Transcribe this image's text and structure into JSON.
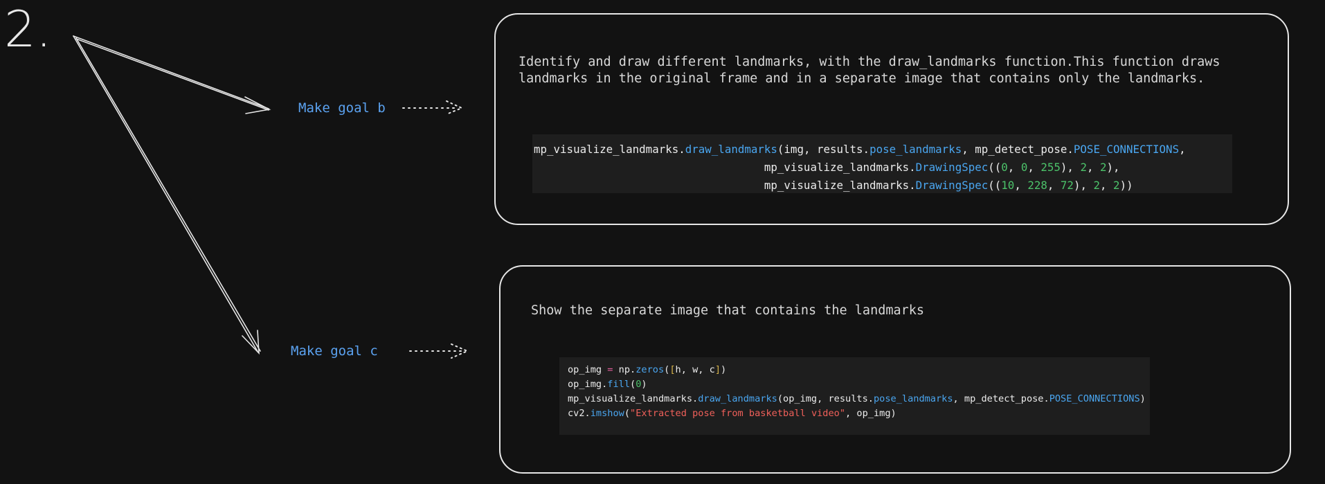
{
  "step": {
    "number": "2."
  },
  "goals": {
    "b": {
      "label": "Make goal b"
    },
    "c": {
      "label": "Make goal c"
    }
  },
  "card_b": {
    "description_line1": "Identify and draw different landmarks, with the draw_landmarks function.This function draws",
    "description_line2": "landmarks in the original frame and in a separate image that contains only the landmarks.",
    "code_lines": [
      [
        {
          "t": "mp_visualize_landmarks.",
          "k": "plain"
        },
        {
          "t": "draw_landmarks",
          "k": "fn"
        },
        {
          "t": "(img, results.",
          "k": "plain"
        },
        {
          "t": "pose_landmarks",
          "k": "fn"
        },
        {
          "t": ", mp_detect_pose.",
          "k": "plain"
        },
        {
          "t": "POSE_CONNECTIONS",
          "k": "fn"
        },
        {
          "t": ",",
          "k": "plain"
        }
      ],
      [
        {
          "t": "                                   mp_visualize_landmarks.",
          "k": "plain"
        },
        {
          "t": "DrawingSpec",
          "k": "fn"
        },
        {
          "t": "((",
          "k": "plain"
        },
        {
          "t": "0",
          "k": "num"
        },
        {
          "t": ", ",
          "k": "plain"
        },
        {
          "t": "0",
          "k": "num"
        },
        {
          "t": ", ",
          "k": "plain"
        },
        {
          "t": "255",
          "k": "num"
        },
        {
          "t": "), ",
          "k": "plain"
        },
        {
          "t": "2",
          "k": "num"
        },
        {
          "t": ", ",
          "k": "plain"
        },
        {
          "t": "2",
          "k": "num"
        },
        {
          "t": "),",
          "k": "plain"
        }
      ],
      [
        {
          "t": "                                   mp_visualize_landmarks.",
          "k": "plain"
        },
        {
          "t": "DrawingSpec",
          "k": "fn"
        },
        {
          "t": "((",
          "k": "plain"
        },
        {
          "t": "10",
          "k": "num"
        },
        {
          "t": ", ",
          "k": "plain"
        },
        {
          "t": "228",
          "k": "num"
        },
        {
          "t": ", ",
          "k": "plain"
        },
        {
          "t": "72",
          "k": "num"
        },
        {
          "t": "), ",
          "k": "plain"
        },
        {
          "t": "2",
          "k": "num"
        },
        {
          "t": ", ",
          "k": "plain"
        },
        {
          "t": "2",
          "k": "num"
        },
        {
          "t": "))",
          "k": "plain"
        }
      ]
    ]
  },
  "card_c": {
    "description": "Show the separate image that contains the landmarks",
    "code_lines": [
      [
        {
          "t": "op_img ",
          "k": "plain"
        },
        {
          "t": "=",
          "k": "op"
        },
        {
          "t": " np.",
          "k": "plain"
        },
        {
          "t": "zeros",
          "k": "fn"
        },
        {
          "t": "(",
          "k": "plain"
        },
        {
          "t": "[",
          "k": "br"
        },
        {
          "t": "h, w, c",
          "k": "plain"
        },
        {
          "t": "]",
          "k": "br"
        },
        {
          "t": ")",
          "k": "plain"
        }
      ],
      [
        {
          "t": "op_img.",
          "k": "plain"
        },
        {
          "t": "fill",
          "k": "fn"
        },
        {
          "t": "(",
          "k": "plain"
        },
        {
          "t": "0",
          "k": "num"
        },
        {
          "t": ")",
          "k": "plain"
        }
      ],
      [
        {
          "t": "mp_visualize_landmarks.",
          "k": "plain"
        },
        {
          "t": "draw_landmarks",
          "k": "fn"
        },
        {
          "t": "(op_img, results.",
          "k": "plain"
        },
        {
          "t": "pose_landmarks",
          "k": "fn"
        },
        {
          "t": ", mp_detect_pose.",
          "k": "plain"
        },
        {
          "t": "POSE_CONNECTIONS",
          "k": "fn"
        },
        {
          "t": ")",
          "k": "plain"
        }
      ],
      [
        {
          "t": "cv2.",
          "k": "plain"
        },
        {
          "t": "imshow",
          "k": "fn"
        },
        {
          "t": "(",
          "k": "plain"
        },
        {
          "t": "\"Extracted pose from basketball video\"",
          "k": "str"
        },
        {
          "t": ", op_img)",
          "k": "plain"
        }
      ]
    ]
  },
  "colors": {
    "background": "#121212",
    "goal_text": "#5ba2f0",
    "card_border": "#e6e6e6",
    "code_bg": "#1e1e1e",
    "function": "#4aa6f0",
    "number": "#4cc26a",
    "string": "#f0605a"
  }
}
